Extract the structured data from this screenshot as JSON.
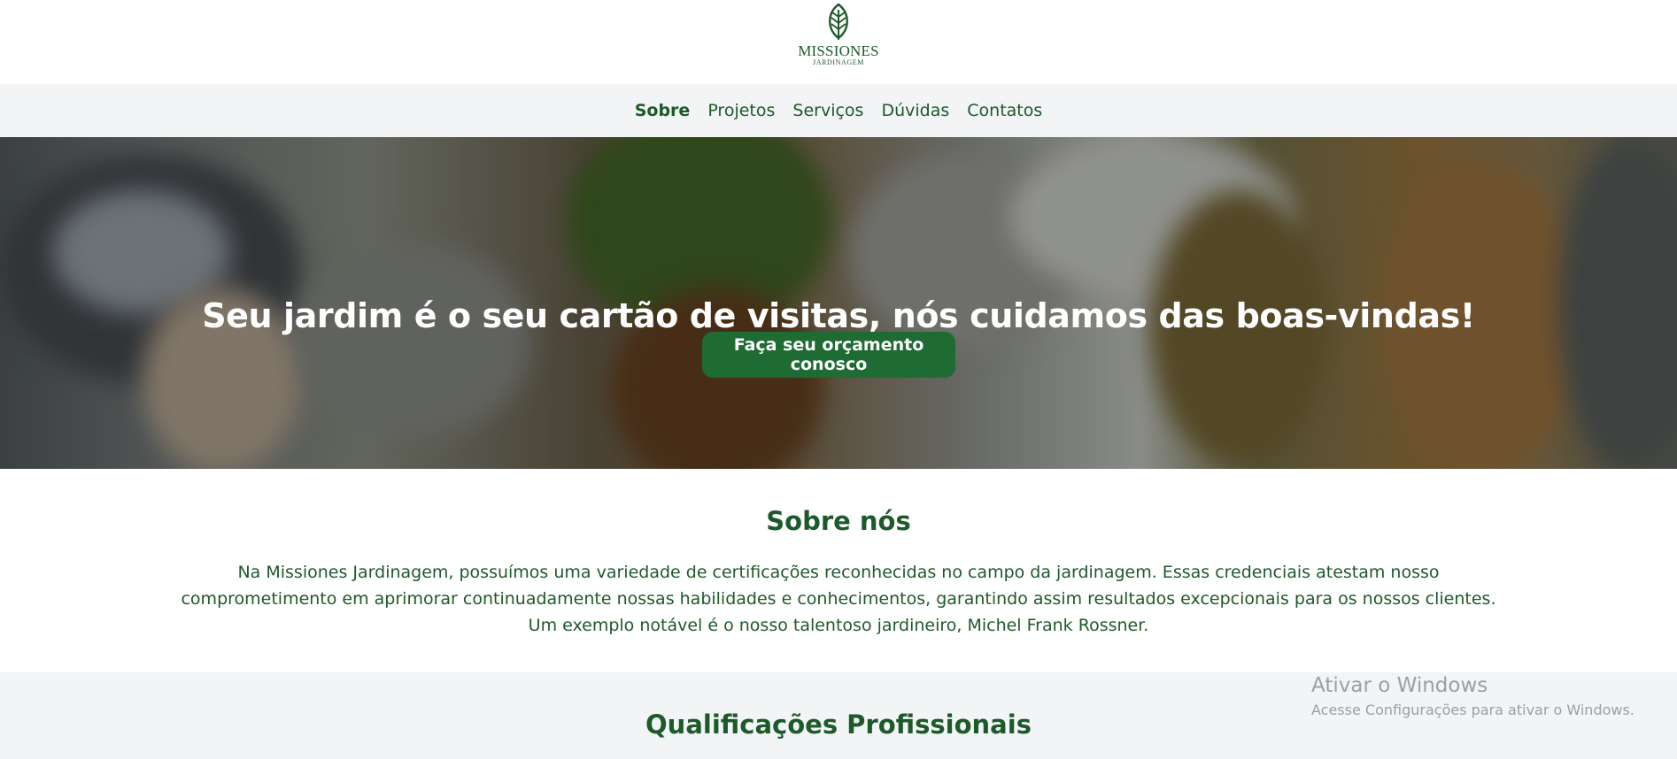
{
  "brand": {
    "name": "MISSIONES",
    "subtitle": "JARDINAGEM",
    "logo_icon": "leaf-icon",
    "color": "#1d5a2a"
  },
  "nav": {
    "items": [
      {
        "label": "Sobre",
        "active": true
      },
      {
        "label": "Projetos",
        "active": false
      },
      {
        "label": "Serviços",
        "active": false
      },
      {
        "label": "Dúvidas",
        "active": false
      },
      {
        "label": "Contatos",
        "active": false
      }
    ]
  },
  "hero": {
    "title": "Seu jardim é o seu cartão de visitas, nós cuidamos das boas-vindas!",
    "cta_label": "Faça seu orçamento conosco",
    "cta_color": "#1e6b33"
  },
  "about": {
    "title": "Sobre nós",
    "text": "Na Missiones Jardinagem, possuímos uma variedade de certificações reconhecidas no campo da jardinagem. Essas credenciais atestam nosso comprometimento em aprimorar continuadamente nossas habilidades e conhecimentos, garantindo assim resultados excepcionais para os nossos clientes. Um exemplo notável é o nosso talentoso jardineiro, Michel Frank Rossner."
  },
  "qualifications": {
    "title": "Qualificações Profissionais"
  },
  "windows_watermark": {
    "title": "Ativar o Windows",
    "subtitle": "Acesse Configurações para ativar o Windows."
  }
}
